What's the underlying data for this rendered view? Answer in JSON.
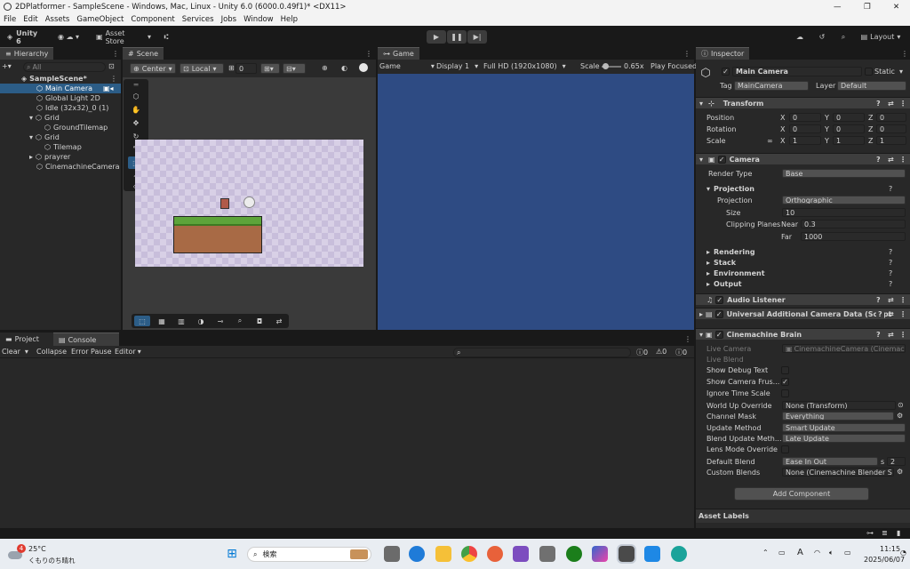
{
  "window": {
    "title": "2DPlatformer - SampleScene - Windows, Mac, Linux - Unity 6.0 (6000.0.49f1)* <DX11>",
    "minimize": "—",
    "maximize": "❐",
    "close": "✕"
  },
  "menu": [
    "File",
    "Edit",
    "Assets",
    "GameObject",
    "Component",
    "Services",
    "Jobs",
    "Window",
    "Help"
  ],
  "toolbar": {
    "account": "Unity 6",
    "asset_store": "Asset Store",
    "layout": "Layout"
  },
  "hierarchy": {
    "tab": "Hierarchy",
    "search_placeholder": "All",
    "scene": "SampleScene*",
    "items": [
      "Main Camera",
      "Global Light 2D",
      "Idle (32x32)_0 (1)",
      "Grid",
      "GroundTilemap",
      "Grid",
      "Tilemap",
      "prayrer",
      "CinemachineCamera"
    ]
  },
  "scene": {
    "tab": "Scene",
    "pivot": "Center",
    "space": "Local",
    "snap_value": "0"
  },
  "game": {
    "tab": "Game",
    "mode": "Game",
    "display": "Display 1",
    "resolution": "Full HD (1920x1080)",
    "scale_label": "Scale",
    "scale_value": "0.65x",
    "play_focused": "Play Focused",
    "scale_fraction": 0.2
  },
  "console": {
    "tabs": [
      "Project",
      "Console"
    ],
    "clear": "Clear",
    "collapse": "Collapse",
    "error_pause": "Error Pause",
    "editor": "Editor",
    "counts": [
      "0",
      "0",
      "0"
    ]
  },
  "inspector": {
    "tab": "Inspector",
    "object_name": "Main Camera",
    "static_label": "Static",
    "tag_label": "Tag",
    "tag_value": "MainCamera",
    "layer_label": "Layer",
    "layer_value": "Default",
    "transform": {
      "title": "Transform",
      "position_label": "Position",
      "rotation_label": "Rotation",
      "scale_label": "Scale",
      "position": [
        "0",
        "0",
        "0"
      ],
      "rotation": [
        "0",
        "0",
        "0"
      ],
      "scale": [
        "1",
        "1",
        "1"
      ],
      "axes": [
        "X",
        "Y",
        "Z"
      ]
    },
    "camera": {
      "title": "Camera",
      "render_type_label": "Render Type",
      "render_type": "Base",
      "projection_section": "Projection",
      "projection_label": "Projection",
      "projection": "Orthographic",
      "size_label": "Size",
      "size": "10",
      "clipping_label": "Clipping Planes",
      "near_label": "Near",
      "near": "0.3",
      "far_label": "Far",
      "far": "1000",
      "sections": [
        "Rendering",
        "Stack",
        "Environment",
        "Output"
      ]
    },
    "audio_listener": "Audio Listener",
    "urp_data": "Universal Additional Camera Data (Script",
    "brain": {
      "title": "Cinemachine Brain",
      "live_camera_label": "Live Camera",
      "live_camera": "CinemachineCamera (Cinemac",
      "live_blend_label": "Live Blend",
      "show_debug_label": "Show Debug Text",
      "show_frustum_label": "Show Camera Frus...",
      "ignore_timescale_label": "Ignore Time Scale",
      "world_up_label": "World Up Override",
      "world_up": "None (Transform)",
      "channel_mask_label": "Channel Mask",
      "channel_mask": "Everything",
      "update_method_label": "Update Method",
      "update_method": "Smart Update",
      "blend_update_label": "Blend Update Meth...",
      "blend_update": "Late Update",
      "lens_mode_label": "Lens Mode Override",
      "default_blend_label": "Default Blend",
      "default_blend": "Ease In Out",
      "blend_s": "s",
      "blend_time": "2",
      "custom_blends_label": "Custom Blends",
      "custom_blends": "None (Cinemachine Blender S"
    },
    "add_component": "Add Component",
    "asset_labels": "Asset Labels"
  },
  "taskbar": {
    "temperature": "25°C",
    "weather": "くもりのち晴れ",
    "badge": "4",
    "search": "検索",
    "ime": "A",
    "time": "11:15",
    "date": "2025/06/07"
  },
  "colors": {
    "game_bg": "#2e4b83",
    "scene_checker_a": "#c8bedb",
    "scene_checker_b": "#d8d0e6",
    "grass": "#5da43a",
    "dirt": "#a86a45",
    "selected": "#2c5d87"
  }
}
